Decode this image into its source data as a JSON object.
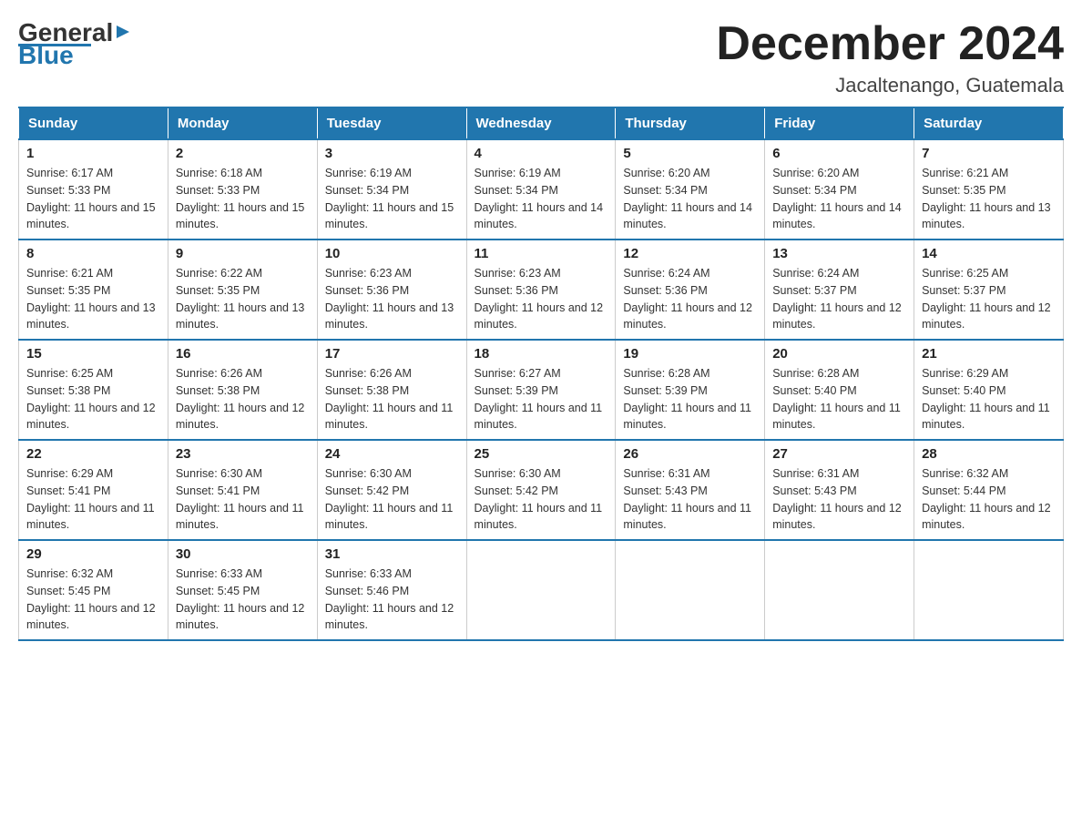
{
  "header": {
    "logo_general": "General",
    "logo_blue": "Blue",
    "month_title": "December 2024",
    "location": "Jacaltenango, Guatemala"
  },
  "weekdays": [
    "Sunday",
    "Monday",
    "Tuesday",
    "Wednesday",
    "Thursday",
    "Friday",
    "Saturday"
  ],
  "weeks": [
    [
      {
        "day": "1",
        "sunrise": "Sunrise: 6:17 AM",
        "sunset": "Sunset: 5:33 PM",
        "daylight": "Daylight: 11 hours and 15 minutes."
      },
      {
        "day": "2",
        "sunrise": "Sunrise: 6:18 AM",
        "sunset": "Sunset: 5:33 PM",
        "daylight": "Daylight: 11 hours and 15 minutes."
      },
      {
        "day": "3",
        "sunrise": "Sunrise: 6:19 AM",
        "sunset": "Sunset: 5:34 PM",
        "daylight": "Daylight: 11 hours and 15 minutes."
      },
      {
        "day": "4",
        "sunrise": "Sunrise: 6:19 AM",
        "sunset": "Sunset: 5:34 PM",
        "daylight": "Daylight: 11 hours and 14 minutes."
      },
      {
        "day": "5",
        "sunrise": "Sunrise: 6:20 AM",
        "sunset": "Sunset: 5:34 PM",
        "daylight": "Daylight: 11 hours and 14 minutes."
      },
      {
        "day": "6",
        "sunrise": "Sunrise: 6:20 AM",
        "sunset": "Sunset: 5:34 PM",
        "daylight": "Daylight: 11 hours and 14 minutes."
      },
      {
        "day": "7",
        "sunrise": "Sunrise: 6:21 AM",
        "sunset": "Sunset: 5:35 PM",
        "daylight": "Daylight: 11 hours and 13 minutes."
      }
    ],
    [
      {
        "day": "8",
        "sunrise": "Sunrise: 6:21 AM",
        "sunset": "Sunset: 5:35 PM",
        "daylight": "Daylight: 11 hours and 13 minutes."
      },
      {
        "day": "9",
        "sunrise": "Sunrise: 6:22 AM",
        "sunset": "Sunset: 5:35 PM",
        "daylight": "Daylight: 11 hours and 13 minutes."
      },
      {
        "day": "10",
        "sunrise": "Sunrise: 6:23 AM",
        "sunset": "Sunset: 5:36 PM",
        "daylight": "Daylight: 11 hours and 13 minutes."
      },
      {
        "day": "11",
        "sunrise": "Sunrise: 6:23 AM",
        "sunset": "Sunset: 5:36 PM",
        "daylight": "Daylight: 11 hours and 12 minutes."
      },
      {
        "day": "12",
        "sunrise": "Sunrise: 6:24 AM",
        "sunset": "Sunset: 5:36 PM",
        "daylight": "Daylight: 11 hours and 12 minutes."
      },
      {
        "day": "13",
        "sunrise": "Sunrise: 6:24 AM",
        "sunset": "Sunset: 5:37 PM",
        "daylight": "Daylight: 11 hours and 12 minutes."
      },
      {
        "day": "14",
        "sunrise": "Sunrise: 6:25 AM",
        "sunset": "Sunset: 5:37 PM",
        "daylight": "Daylight: 11 hours and 12 minutes."
      }
    ],
    [
      {
        "day": "15",
        "sunrise": "Sunrise: 6:25 AM",
        "sunset": "Sunset: 5:38 PM",
        "daylight": "Daylight: 11 hours and 12 minutes."
      },
      {
        "day": "16",
        "sunrise": "Sunrise: 6:26 AM",
        "sunset": "Sunset: 5:38 PM",
        "daylight": "Daylight: 11 hours and 12 minutes."
      },
      {
        "day": "17",
        "sunrise": "Sunrise: 6:26 AM",
        "sunset": "Sunset: 5:38 PM",
        "daylight": "Daylight: 11 hours and 11 minutes."
      },
      {
        "day": "18",
        "sunrise": "Sunrise: 6:27 AM",
        "sunset": "Sunset: 5:39 PM",
        "daylight": "Daylight: 11 hours and 11 minutes."
      },
      {
        "day": "19",
        "sunrise": "Sunrise: 6:28 AM",
        "sunset": "Sunset: 5:39 PM",
        "daylight": "Daylight: 11 hours and 11 minutes."
      },
      {
        "day": "20",
        "sunrise": "Sunrise: 6:28 AM",
        "sunset": "Sunset: 5:40 PM",
        "daylight": "Daylight: 11 hours and 11 minutes."
      },
      {
        "day": "21",
        "sunrise": "Sunrise: 6:29 AM",
        "sunset": "Sunset: 5:40 PM",
        "daylight": "Daylight: 11 hours and 11 minutes."
      }
    ],
    [
      {
        "day": "22",
        "sunrise": "Sunrise: 6:29 AM",
        "sunset": "Sunset: 5:41 PM",
        "daylight": "Daylight: 11 hours and 11 minutes."
      },
      {
        "day": "23",
        "sunrise": "Sunrise: 6:30 AM",
        "sunset": "Sunset: 5:41 PM",
        "daylight": "Daylight: 11 hours and 11 minutes."
      },
      {
        "day": "24",
        "sunrise": "Sunrise: 6:30 AM",
        "sunset": "Sunset: 5:42 PM",
        "daylight": "Daylight: 11 hours and 11 minutes."
      },
      {
        "day": "25",
        "sunrise": "Sunrise: 6:30 AM",
        "sunset": "Sunset: 5:42 PM",
        "daylight": "Daylight: 11 hours and 11 minutes."
      },
      {
        "day": "26",
        "sunrise": "Sunrise: 6:31 AM",
        "sunset": "Sunset: 5:43 PM",
        "daylight": "Daylight: 11 hours and 11 minutes."
      },
      {
        "day": "27",
        "sunrise": "Sunrise: 6:31 AM",
        "sunset": "Sunset: 5:43 PM",
        "daylight": "Daylight: 11 hours and 12 minutes."
      },
      {
        "day": "28",
        "sunrise": "Sunrise: 6:32 AM",
        "sunset": "Sunset: 5:44 PM",
        "daylight": "Daylight: 11 hours and 12 minutes."
      }
    ],
    [
      {
        "day": "29",
        "sunrise": "Sunrise: 6:32 AM",
        "sunset": "Sunset: 5:45 PM",
        "daylight": "Daylight: 11 hours and 12 minutes."
      },
      {
        "day": "30",
        "sunrise": "Sunrise: 6:33 AM",
        "sunset": "Sunset: 5:45 PM",
        "daylight": "Daylight: 11 hours and 12 minutes."
      },
      {
        "day": "31",
        "sunrise": "Sunrise: 6:33 AM",
        "sunset": "Sunset: 5:46 PM",
        "daylight": "Daylight: 11 hours and 12 minutes."
      },
      null,
      null,
      null,
      null
    ]
  ]
}
